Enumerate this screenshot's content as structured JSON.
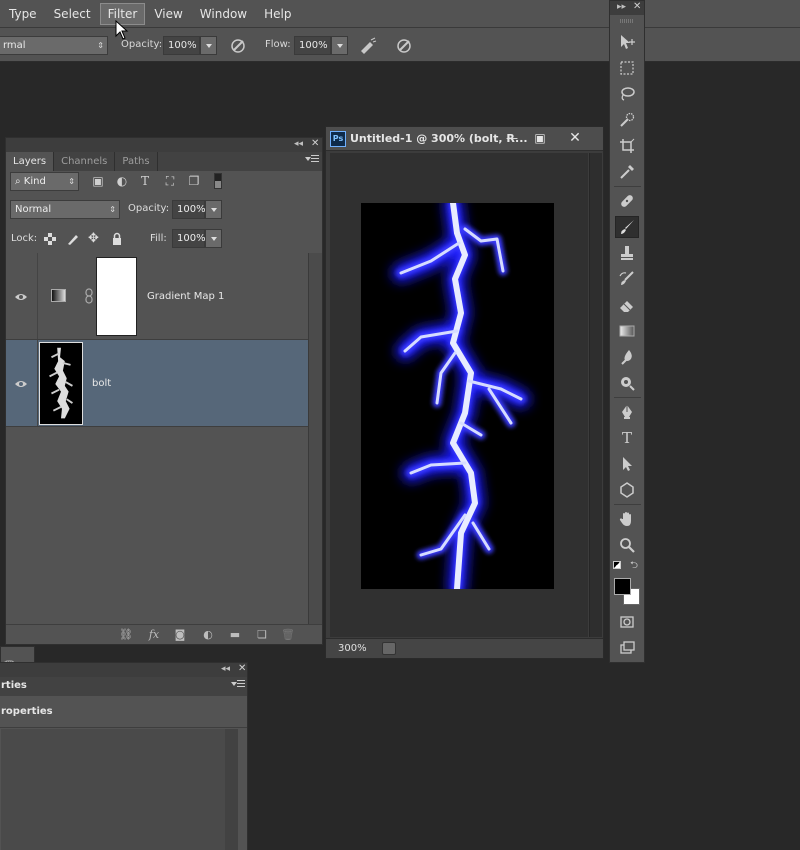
{
  "menu": {
    "items": [
      "Type",
      "Select",
      "Filter",
      "View",
      "Window",
      "Help"
    ],
    "active": "Filter"
  },
  "options_bar": {
    "mode_value": "rmal",
    "opacity_label": "Opacity:",
    "opacity_value": "100%",
    "flow_label": "Flow:",
    "flow_value": "100%"
  },
  "layers_panel": {
    "tabs": [
      "Layers",
      "Channels",
      "Paths"
    ],
    "active_tab": "Layers",
    "kind_label": "Kind",
    "blend_mode": "Normal",
    "opacity_label": "Opacity:",
    "opacity_value": "100%",
    "lock_label": "Lock:",
    "fill_label": "Fill:",
    "fill_value": "100%",
    "layers": [
      {
        "name": "Gradient Map 1",
        "type": "adjustment",
        "selected": false
      },
      {
        "name": "bolt",
        "type": "pixel",
        "selected": true
      }
    ]
  },
  "properties_panel": {
    "tab_fragment": "rties",
    "heading_fragment": "roperties"
  },
  "document": {
    "title": "Untitled-1 @ 300% (bolt, R...",
    "badge": "Ps",
    "zoom": "300%"
  },
  "tools": [
    "move-icon",
    "marquee-icon",
    "lasso-icon",
    "quick-select-icon",
    "crop-icon",
    "eyedropper-icon",
    "healing-brush-icon",
    "brush-icon",
    "clone-stamp-icon",
    "history-brush-icon",
    "eraser-icon",
    "gradient-icon",
    "blur-icon",
    "dodge-icon",
    "pen-icon",
    "type-icon",
    "path-select-icon",
    "shape-icon",
    "hand-icon",
    "zoom-icon"
  ],
  "active_tool": "brush-icon",
  "colors": {
    "foreground": "#000000",
    "background": "#ffffff",
    "bolt_glow": "#1a1aff",
    "selection": "#566779"
  }
}
